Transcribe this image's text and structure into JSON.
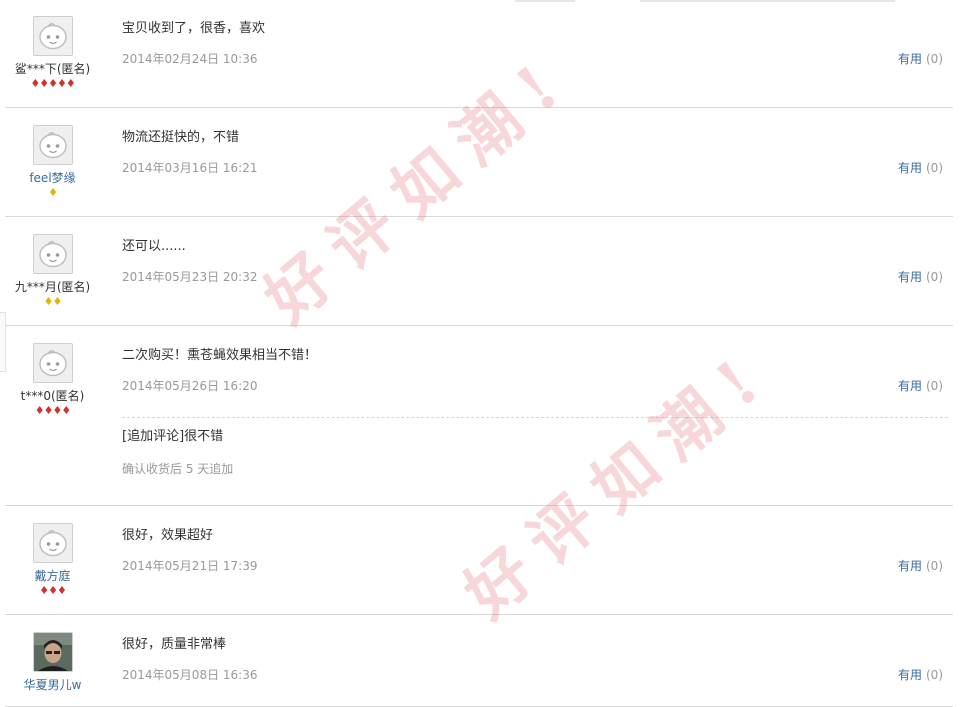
{
  "useful_label": "有用",
  "watermark_text": "好评如潮!",
  "colors": {
    "link": "#3a6b9e",
    "meta": "#999999",
    "divider": "#d9d9d9",
    "watermark": "#e16e78"
  },
  "reviews": [
    {
      "user": "鲨***下(匿名)",
      "level": {
        "gem": "red",
        "count": 5
      },
      "avatar": "default-avatar",
      "text": "宝贝收到了，很香，喜欢",
      "date": "2014年02月24日 10:36",
      "useful_count": "(0)"
    },
    {
      "user": "feel梦缘",
      "level": {
        "gem": "gold",
        "count": 1
      },
      "avatar": "default-avatar",
      "text": "物流还挺快的，不错",
      "date": "2014年03月16日 16:21",
      "useful_count": "(0)"
    },
    {
      "user": "九***月(匿名)",
      "level": {
        "gem": "gold",
        "count": 2
      },
      "avatar": "default-avatar",
      "text": "还可以......",
      "date": "2014年05月23日 20:32",
      "useful_count": "(0)"
    },
    {
      "user": "t***0(匿名)",
      "level": {
        "gem": "red",
        "count": 4
      },
      "avatar": "default-avatar",
      "text": "二次购买！熏苍蝇效果相当不错！",
      "date": "2014年05月26日 16:20",
      "useful_count": "(0)",
      "append": {
        "text": "[追加评论]很不错",
        "note": "确认收货后 5 天追加"
      }
    },
    {
      "user": "戴方庭",
      "level": {
        "gem": "red",
        "count": 3
      },
      "avatar": "default-avatar",
      "text": "很好，效果超好",
      "date": "2014年05月21日 17:39",
      "useful_count": "(0)"
    },
    {
      "user": "华夏男儿w",
      "level": {
        "gem": "none",
        "count": 0
      },
      "avatar": "photo-avatar",
      "text": "很好，质量非常棒",
      "date": "2014年05月08日 16:36",
      "useful_count": "(0)"
    }
  ]
}
